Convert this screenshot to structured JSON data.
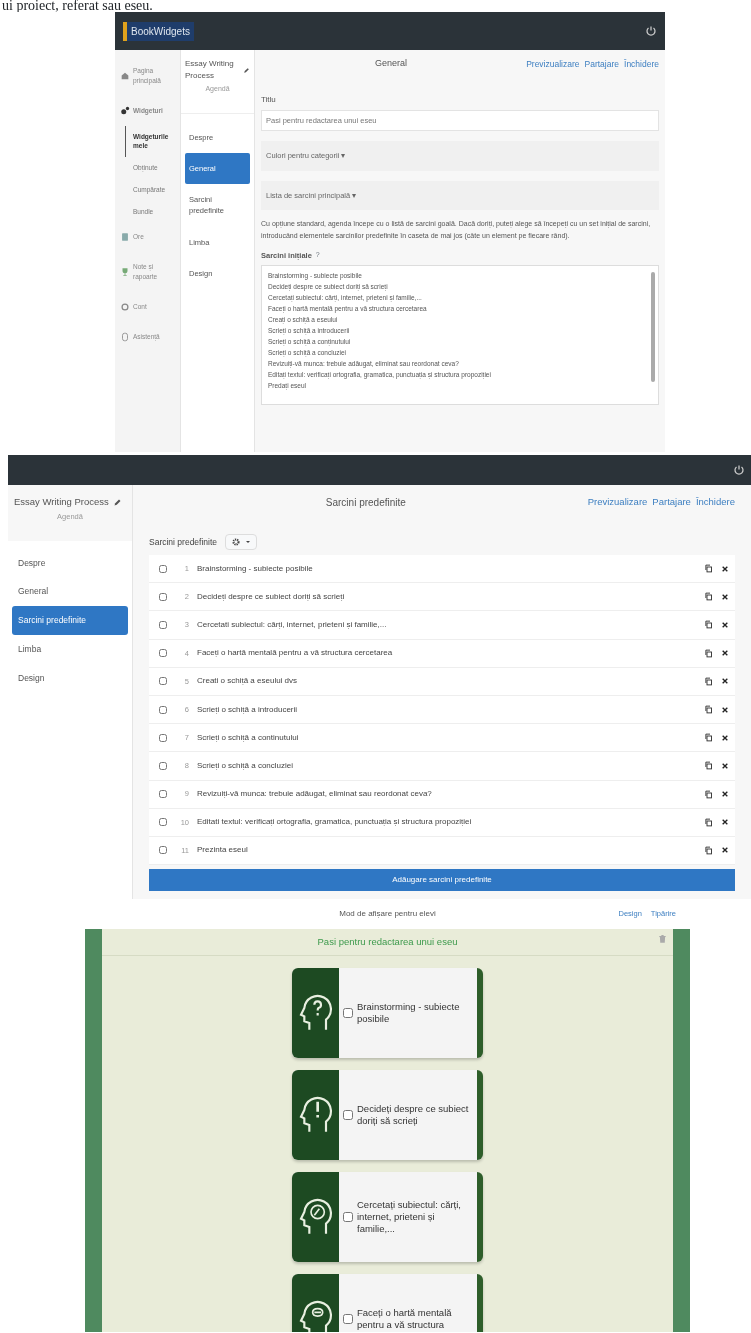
{
  "intro_text": "ui proiect, referat sau eseu.",
  "screenshot_1": {
    "logo": "BookWidgets",
    "sidebar": [
      {
        "kind": "home",
        "label": "Pagina principală",
        "selected": false
      },
      {
        "kind": "widgets",
        "label": "Widgeturi",
        "selected": false
      },
      {
        "kind": "sub",
        "label": "Widgeturile mele",
        "selected": true
      },
      {
        "kind": "sub",
        "label": "Obținute",
        "selected": false
      },
      {
        "kind": "sub",
        "label": "Cumpărate",
        "selected": false
      },
      {
        "kind": "sub",
        "label": "Bundle",
        "selected": false
      },
      {
        "kind": "lessons",
        "label": "Ore",
        "selected": false
      },
      {
        "kind": "results",
        "label": "Note și rapoarte",
        "selected": false
      },
      {
        "kind": "account",
        "label": "Cont",
        "selected": false
      },
      {
        "kind": "help",
        "label": "Asistență",
        "selected": false
      }
    ],
    "project_title": "Essay Writing Process",
    "project_subtitle": "Agendă",
    "menu": [
      {
        "label": "Despre",
        "selected": false
      },
      {
        "label": "General",
        "selected": true
      },
      {
        "label": "Sarcini predefinite",
        "selected": false
      },
      {
        "label": "Limba",
        "selected": false
      },
      {
        "label": "Design",
        "selected": false
      }
    ],
    "page_title": "General",
    "header_links": [
      "Previzualizare",
      "Partajare",
      "Închidere"
    ],
    "title_label": "Titlu",
    "title_value": "Pasi pentru redactarea unui eseu",
    "sections": [
      "Culori pentru categorii ▾",
      "Lista de sarcini principală ▾"
    ],
    "description": "Cu opțiune standard, agenda începe cu o listă de sarcini goală. Dacă doriți, puteți alege să începeți cu un set inițial de sarcini, introducând elementele sarcinilor predefinite în caseta de mai jos (câte un element pe fiecare rând).",
    "initial_tasks_label": "Sarcini inițiale",
    "help_mark": "?",
    "initial_tasks_lines": [
      "Brainstorming - subiecte posibile",
      "Decideți despre ce subiect doriți să scrieți",
      "Cercetați subiectul: cărți, internet, prieteni și familie,...",
      "Faceți o hartă mentală pentru a vă structura cercetarea",
      "Creați o schiță a eseului",
      "Scrieți o schiță a introducerii",
      "Scrieți o schiță a conținutului",
      "Scrieți o schiță a concluziei",
      "Revizuiți-vă munca: trebuie adăugat, eliminat sau reordonat ceva?",
      "Editați textul: verificați ortografia, gramatica, punctuația și structura propoziției",
      "Predați eseul"
    ]
  },
  "screenshot_2": {
    "project_title": "Essay Writing Process",
    "project_subtitle": "Agendă",
    "menu": [
      {
        "label": "Despre",
        "selected": false
      },
      {
        "label": "General",
        "selected": false
      },
      {
        "label": "Sarcini predefinite",
        "selected": true
      },
      {
        "label": "Limba",
        "selected": false
      },
      {
        "label": "Design",
        "selected": false
      }
    ],
    "page_title": "Sarcini predefinite",
    "header_links": [
      "Previzualizare",
      "Partajare",
      "Închidere"
    ],
    "tasks_label": "Sarcini predefinite",
    "tasks": [
      {
        "number": "1",
        "text": "Brainstorming - subiecte posibile",
        "checked": false
      },
      {
        "number": "2",
        "text": "Decideți despre ce subiect doriți să scrieți",
        "checked": false
      },
      {
        "number": "3",
        "text": "Cercetati subiectul: cărți, internet, prieteni și familie,...",
        "checked": false
      },
      {
        "number": "4",
        "text": "Faceți o hartă mentală pentru a vă structura cercetarea",
        "checked": false
      },
      {
        "number": "5",
        "text": "Creati o schiță a eseului dvs",
        "checked": false
      },
      {
        "number": "6",
        "text": "Scrieți o schiță a introducerii",
        "checked": false
      },
      {
        "number": "7",
        "text": "Scrieți o schiță a continutului",
        "checked": false
      },
      {
        "number": "8",
        "text": "Scrieți o schiță a concluziei",
        "checked": false
      },
      {
        "number": "9",
        "text": "Revizuiți-vă munca: trebuie adăugat, eliminat sau reordonat ceva?",
        "checked": false
      },
      {
        "number": "10",
        "text": "Editati textul: verificați ortografia, gramatica, punctuația și structura propoziției",
        "checked": false
      },
      {
        "number": "11",
        "text": "Prezinta eseul",
        "checked": false
      }
    ],
    "add_button": "Adăugare sarcini predefinite"
  },
  "screenshot_3": {
    "mode_title": "Mod de afișare pentru elevi",
    "header_links": [
      "Design",
      "Tipărire"
    ],
    "board_title": "Pasi pentru redactarea unui eseu",
    "cards": [
      {
        "kind": "question",
        "text": "Brainstorming - subiecte posibile",
        "checked": false
      },
      {
        "kind": "exclamation",
        "text": "Decideți despre ce subiect doriți să scrieți",
        "checked": false
      },
      {
        "kind": "compass",
        "text": "Cercetați subiectul: cărți, internet, prieteni și familie,...",
        "checked": false
      },
      {
        "kind": "brain",
        "text": "Faceți o hartă mentală pentru a vă structura",
        "checked": false
      }
    ]
  }
}
